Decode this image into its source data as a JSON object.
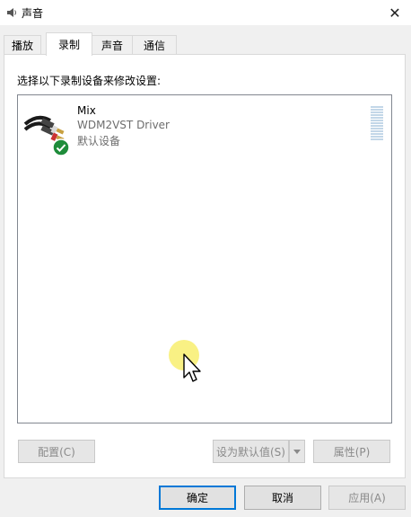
{
  "window": {
    "title": "声音",
    "title_icon": "speaker-icon",
    "close_glyph": "✕"
  },
  "tabs": [
    {
      "label": "播放",
      "active": false
    },
    {
      "label": "录制",
      "active": true
    },
    {
      "label": "声音",
      "active": false
    },
    {
      "label": "通信",
      "active": false
    }
  ],
  "panel": {
    "instruction": "选择以下录制设备来修改设置:",
    "devices": [
      {
        "name": "Mix",
        "driver": "WDM2VST Driver",
        "status": "默认设备",
        "icon": "rca-cable-icon",
        "badge": "green-check-icon"
      }
    ],
    "buttons": {
      "configure": "配置(C)",
      "set_default": "设为默认值(S)",
      "properties": "属性(P)"
    }
  },
  "footer": {
    "ok": "确定",
    "cancel": "取消",
    "apply": "应用(A)"
  },
  "colors": {
    "accent": "#0078d7",
    "check_green": "#1e8c3a",
    "level_meter": "#c3d7e8",
    "cursor_highlight": "#f8ee6e"
  }
}
